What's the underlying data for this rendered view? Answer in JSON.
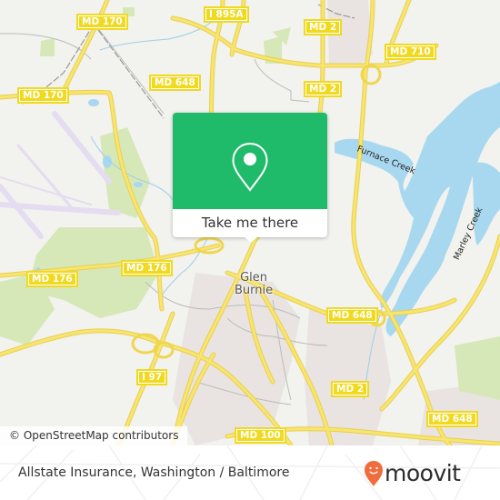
{
  "map": {
    "colors": {
      "land": "#f2f2ee",
      "water": "#a8d8ef",
      "park": "#d4e6b5",
      "urban": "#e8e3e0",
      "road_primary": "#f6e36b",
      "airport": "#e6dff0",
      "shield_fill": "#f0d91f"
    },
    "road_labels": [
      {
        "id": "md170-top",
        "text": "MD 170"
      },
      {
        "id": "i895a",
        "text": "I 895A"
      },
      {
        "id": "md2-top",
        "text": "MD 2"
      },
      {
        "id": "md710",
        "text": "MD 710"
      },
      {
        "id": "md170-left",
        "text": "MD 170"
      },
      {
        "id": "md648-top",
        "text": "MD 648"
      },
      {
        "id": "md2-mid",
        "text": "MD 2"
      },
      {
        "id": "md176-left",
        "text": "MD 176"
      },
      {
        "id": "md176-mid",
        "text": "MD 176"
      },
      {
        "id": "md648-right",
        "text": "MD 648"
      },
      {
        "id": "i97",
        "text": "I 97"
      },
      {
        "id": "md2-bottom",
        "text": "MD 2"
      },
      {
        "id": "md648-bottom",
        "text": "MD 648"
      },
      {
        "id": "md100",
        "text": "MD 100"
      }
    ],
    "place_labels": {
      "glen_burnie_line1": "Glen",
      "glen_burnie_line2": "Burnie"
    },
    "water_labels": {
      "furnace_creek": "Furnace Creek",
      "marley_creek": "Marley Creek"
    },
    "attribution": "© OpenStreetMap contributors"
  },
  "popup": {
    "icon": "map-pin-icon",
    "cta_label": "Take me there",
    "accent": "#1fba6a"
  },
  "footer": {
    "title": "Allstate Insurance, Washington / Baltimore",
    "logo_text": "moovit",
    "logo_color": "#f26b3a"
  }
}
